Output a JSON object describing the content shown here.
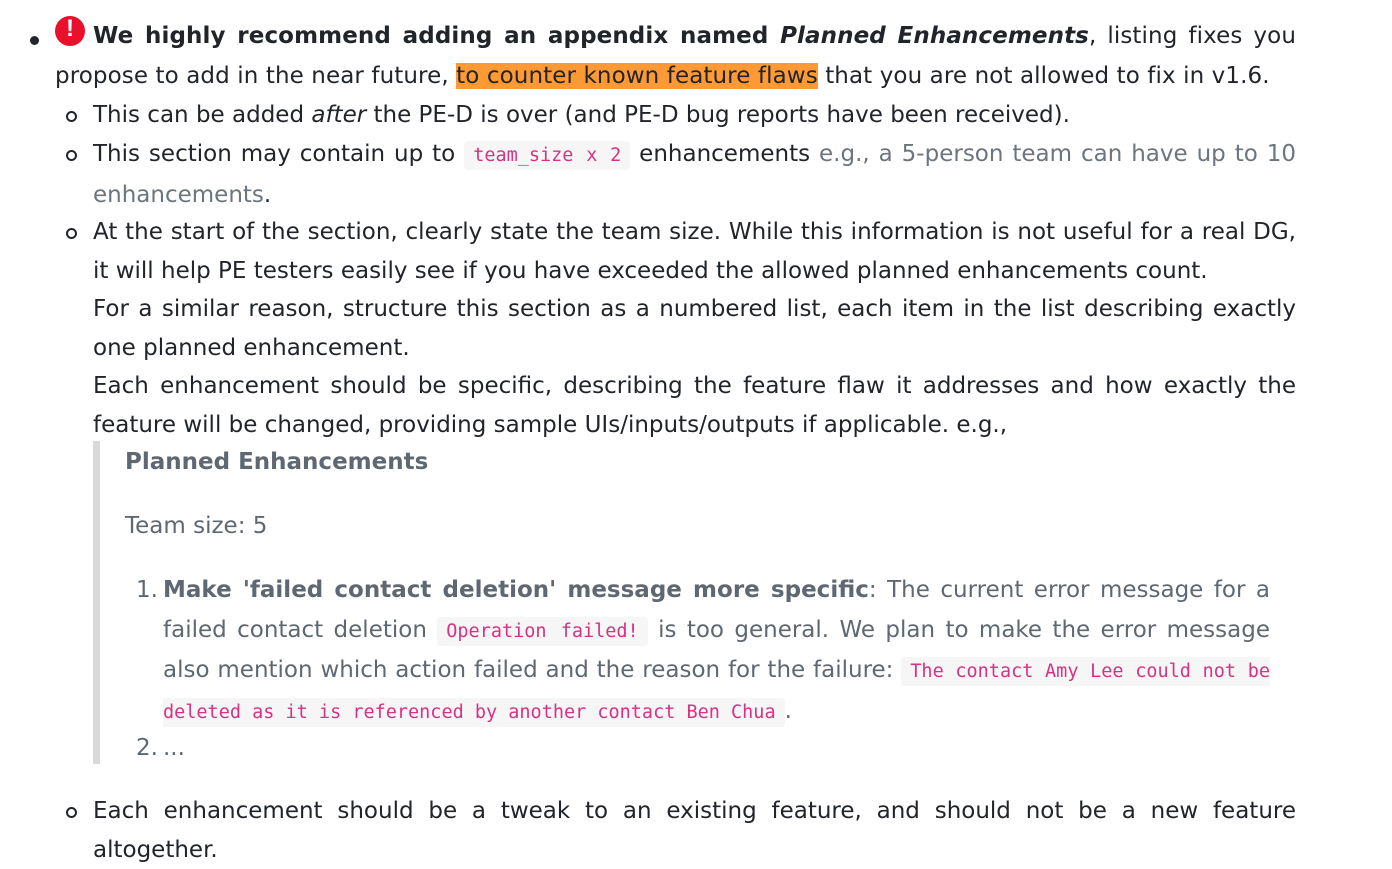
{
  "main_item": {
    "icon": "exclamation-circle-icon",
    "icon_glyph": "!",
    "bold_lead": "We highly recommend adding an appendix named ",
    "bold_italic_name": "Planned Enhancements",
    "after_name": ", listing fixes you propose to add in the near future, ",
    "highlight": "to counter known feature flaws",
    "after_highlight": " that you are not allowed to fix in v1.6."
  },
  "sub_items": {
    "item1": {
      "before": "This can be added ",
      "italic": "after",
      "after": " the PE-D is over (and PE-D bug reports have been received)."
    },
    "item2": {
      "before": "This section may contain up to ",
      "code": "team_size x 2",
      "after": " enhancements ",
      "muted": "e.g., a 5-person team can have up to 10 enhancements",
      "end": "."
    },
    "item3": {
      "line1": "At the start of the section, clearly state the team size. While this information is not useful for a real DG, it will help PE testers easily see if you have exceeded the allowed planned enhancements count.",
      "line2": "For a similar reason, structure this section as a numbered list, each item in the list describing exactly one planned enhancement.",
      "line3": "Each enhancement should be specific, describing the feature flaw it addresses and how exactly the feature will be changed, providing sample UIs/inputs/outputs if applicable. e.g.,"
    },
    "item4": {
      "text": "Each enhancement should be a tweak to an existing feature, and should not be a new feature altogether."
    }
  },
  "example": {
    "title": "Planned Enhancements",
    "team_size": "Team size: 5",
    "list_num1": "1.",
    "item1_bold": "Make 'failed contact deletion' message more specific",
    "item1_text1": ": The current error message for a failed contact deletion ",
    "item1_code1": "Operation failed!",
    "item1_text2": " is too general. We plan to make the error message also mention which action failed and the reason for the failure: ",
    "item1_code2": "The contact Amy Lee could not be deleted as it is referenced by another contact Ben Chua",
    "item1_end": ".",
    "list_num2": "2.",
    "item2_text": "..."
  }
}
